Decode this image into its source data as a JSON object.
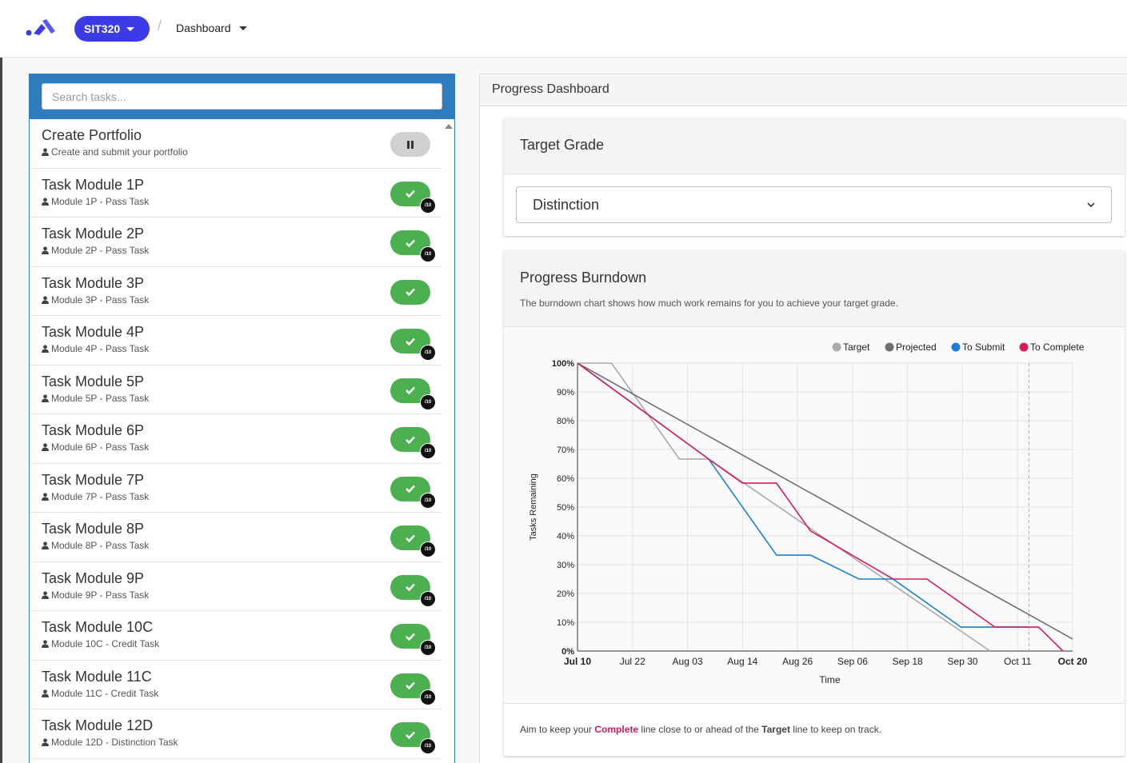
{
  "header": {
    "unit_label": "SIT320",
    "breadcrumb": "Dashboard"
  },
  "search": {
    "placeholder": "Search tasks..."
  },
  "tasks": [
    {
      "name": "Create Portfolio",
      "sub": "Create and submit your portfolio",
      "status": "paused",
      "badge": ""
    },
    {
      "name": "Task Module 1P",
      "sub": "Module 1P - Pass Task",
      "status": "complete",
      "badge": "/10"
    },
    {
      "name": "Task Module 2P",
      "sub": "Module 2P - Pass Task",
      "status": "complete",
      "badge": "/10"
    },
    {
      "name": "Task Module 3P",
      "sub": "Module 3P - Pass Task",
      "status": "complete",
      "badge": ""
    },
    {
      "name": "Task Module 4P",
      "sub": "Module 4P - Pass Task",
      "status": "complete",
      "badge": "/10"
    },
    {
      "name": "Task Module 5P",
      "sub": "Module 5P - Pass Task",
      "status": "complete",
      "badge": "/10"
    },
    {
      "name": "Task Module 6P",
      "sub": "Module 6P - Pass Task",
      "status": "complete",
      "badge": "/10"
    },
    {
      "name": "Task Module 7P",
      "sub": "Module 7P - Pass Task",
      "status": "complete",
      "badge": "/10"
    },
    {
      "name": "Task Module 8P",
      "sub": "Module 8P - Pass Task",
      "status": "complete",
      "badge": "/10"
    },
    {
      "name": "Task Module 9P",
      "sub": "Module 9P - Pass Task",
      "status": "complete",
      "badge": "/10"
    },
    {
      "name": "Task Module 10C",
      "sub": "Module 10C - Credit Task",
      "status": "complete",
      "badge": "/10"
    },
    {
      "name": "Task Module 11C",
      "sub": "Module 11C - Credit Task",
      "status": "complete",
      "badge": "/10"
    },
    {
      "name": "Task Module 12D",
      "sub": "Module 12D - Distinction Task",
      "status": "complete",
      "badge": "/10"
    }
  ],
  "dashboard": {
    "title": "Progress Dashboard",
    "target_grade": {
      "title": "Target Grade",
      "selected": "Distinction"
    },
    "burndown": {
      "title": "Progress Burndown",
      "description": "The burndown chart shows how much work remains for you to achieve your target grade.",
      "footer": {
        "pre": "Aim to keep your ",
        "complete": "Complete",
        "mid": " line close to or ahead of the ",
        "target": "Target",
        "post": " line to keep on track."
      }
    }
  },
  "colors": {
    "brand": "#3b3be8",
    "task_header": "#2f7bbf",
    "complete_green": "#4caf50",
    "target": "#aaaaaa",
    "projected": "#707070",
    "to_submit": "#1e7fd4",
    "to_complete": "#d81b60"
  },
  "chart_data": {
    "type": "line",
    "xlabel": "Time",
    "ylabel": "Tasks Remaining",
    "x_ticks": [
      "Jul 10",
      "Jul 22",
      "Aug 03",
      "Aug 14",
      "Aug 26",
      "Sep 06",
      "Sep 18",
      "Sep 30",
      "Oct 11",
      "Oct 20"
    ],
    "y_ticks": [
      "0%",
      "10%",
      "20%",
      "30%",
      "40%",
      "50%",
      "60%",
      "70%",
      "80%",
      "90%",
      "100%"
    ],
    "ylim": [
      0,
      100
    ],
    "xlim": [
      "2023-07-10",
      "2023-10-20"
    ],
    "legend_position": "top-right",
    "grid": true,
    "marker_line_date": "2023-10-11",
    "series": [
      {
        "name": "Target",
        "color": "#aaaaaa",
        "points": [
          [
            "2023-07-10",
            100
          ],
          [
            "2023-07-17",
            100
          ],
          [
            "2023-07-31",
            66.7
          ],
          [
            "2023-08-06",
            66.7
          ],
          [
            "2023-10-03",
            0
          ]
        ]
      },
      {
        "name": "Projected",
        "color": "#707070",
        "points": [
          [
            "2023-07-10",
            100
          ],
          [
            "2023-10-20",
            4.2
          ]
        ]
      },
      {
        "name": "To Submit",
        "color": "#1e7fd4",
        "points": [
          [
            "2023-07-10",
            100
          ],
          [
            "2023-08-06",
            66.7
          ],
          [
            "2023-08-20",
            33.3
          ],
          [
            "2023-08-27",
            33.3
          ],
          [
            "2023-09-06",
            25
          ],
          [
            "2023-09-13",
            25
          ],
          [
            "2023-09-27",
            8.3
          ],
          [
            "2023-10-11",
            8.3
          ],
          [
            "2023-10-11",
            8.3
          ]
        ]
      },
      {
        "name": "To Complete",
        "color": "#d81b60",
        "points": [
          [
            "2023-07-10",
            100
          ],
          [
            "2023-08-06",
            66.7
          ],
          [
            "2023-08-13",
            58.3
          ],
          [
            "2023-08-20",
            58.3
          ],
          [
            "2023-08-27",
            41.7
          ],
          [
            "2023-09-13",
            25
          ],
          [
            "2023-09-20",
            25
          ],
          [
            "2023-10-04",
            8.3
          ],
          [
            "2023-10-13",
            8.3
          ],
          [
            "2023-10-18",
            0
          ]
        ]
      }
    ]
  }
}
